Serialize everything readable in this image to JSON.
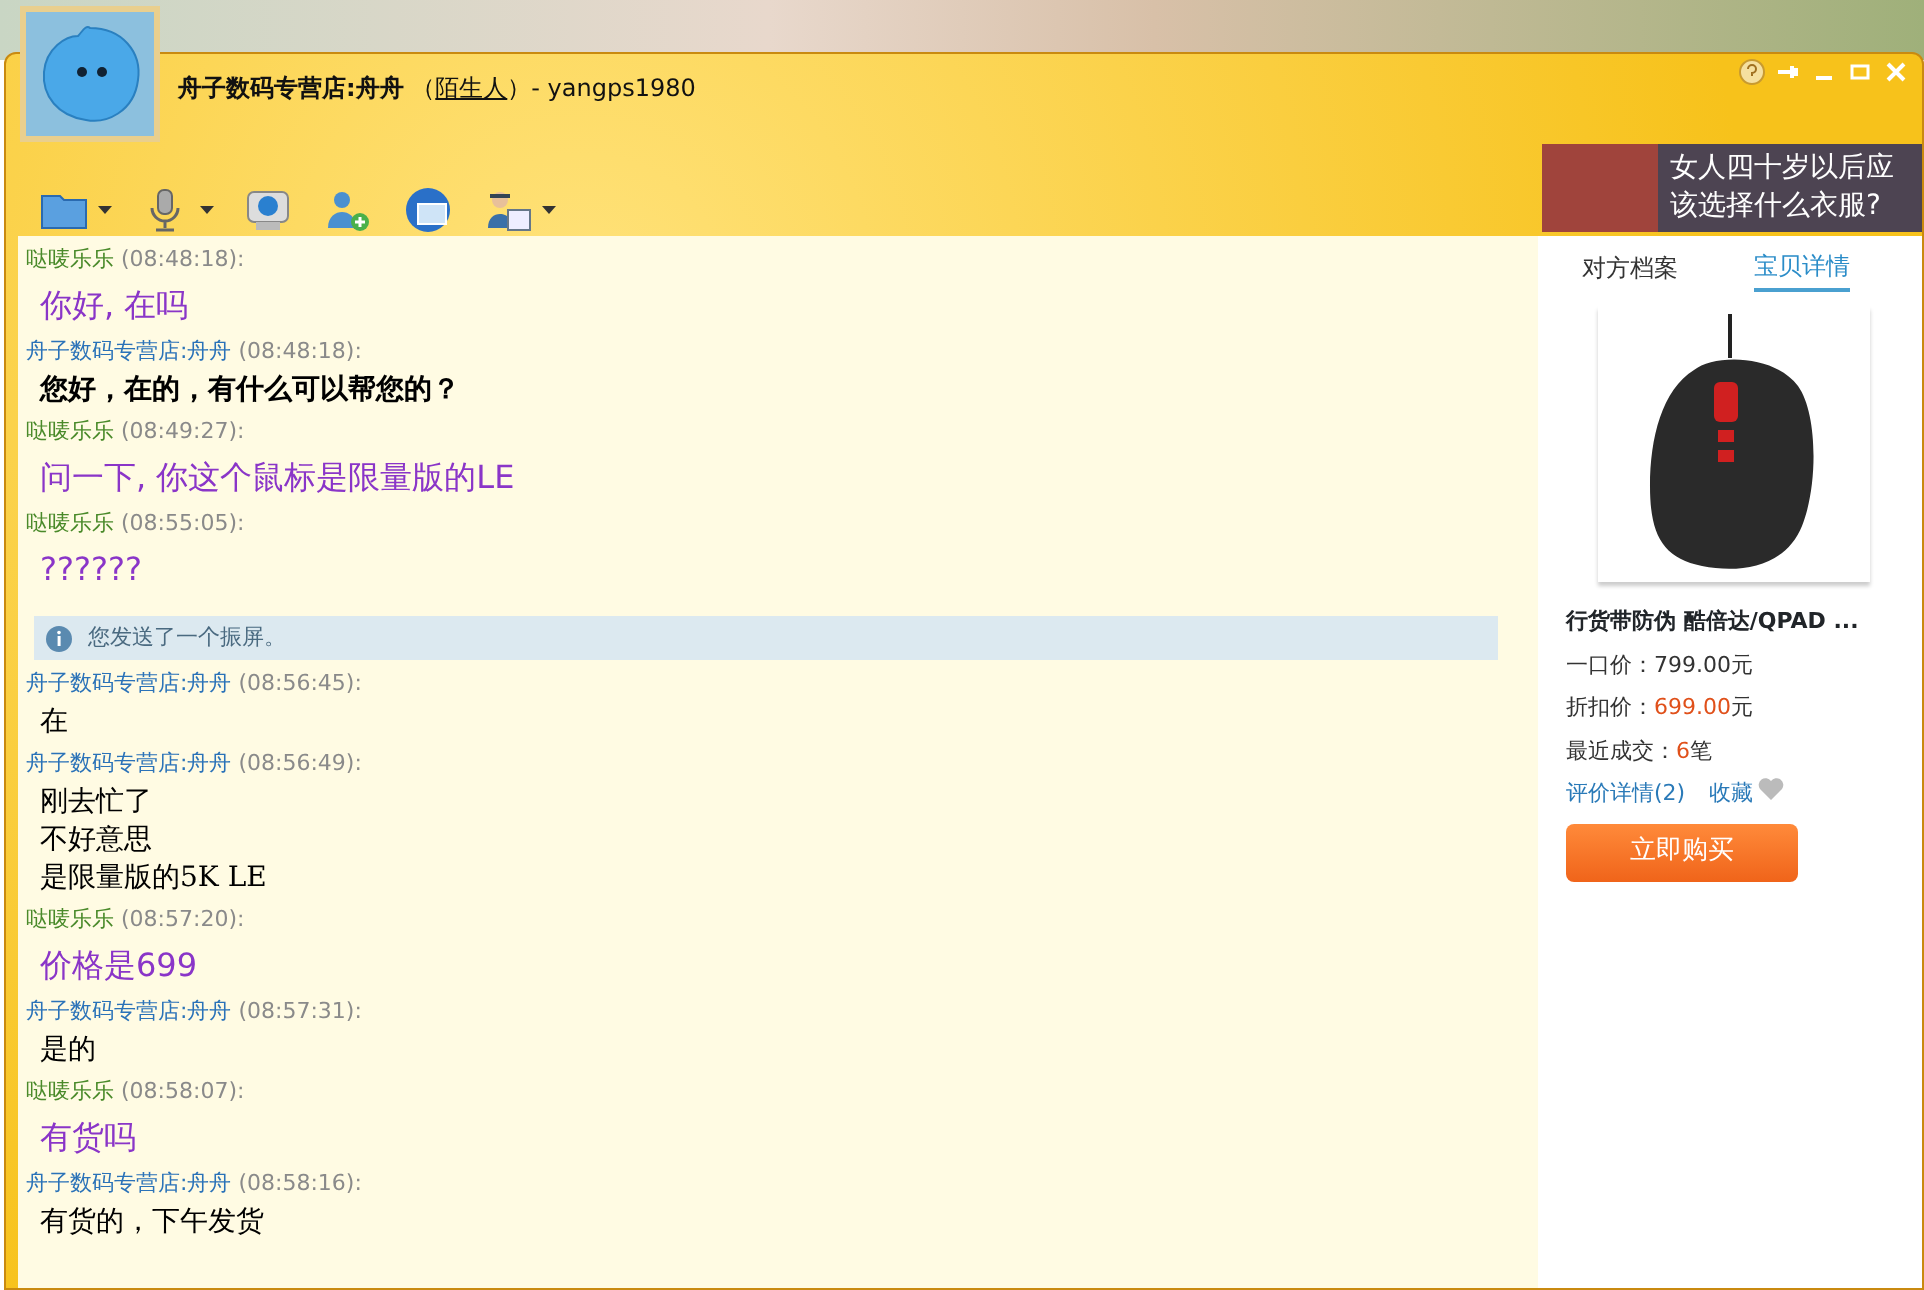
{
  "window": {
    "title_name": "舟子数码专营店:舟舟",
    "relation_open": "（",
    "relation": "陌生人",
    "relation_close": "）- yangps1980"
  },
  "toolbar": [
    {
      "kind": "folder",
      "has_menu": true
    },
    {
      "kind": "microphone",
      "has_menu": true
    },
    {
      "kind": "camera",
      "has_menu": false
    },
    {
      "kind": "contact",
      "has_menu": false
    },
    {
      "kind": "globe",
      "has_menu": false
    },
    {
      "kind": "agent",
      "has_menu": true
    }
  ],
  "ad": {
    "lines": [
      "女人四十岁以后应",
      "该选择什么衣服?"
    ]
  },
  "messages": [
    {
      "kind": "buyer",
      "sender": "哒唛乐乐",
      "time": "(08:48:18):",
      "lines": [
        "你好, 在吗"
      ],
      "bold": false
    },
    {
      "kind": "seller",
      "sender": "舟子数码专营店:舟舟",
      "time": "(08:48:18):",
      "lines": [
        "您好，在的，有什么可以帮您的？"
      ],
      "bold": true
    },
    {
      "kind": "buyer",
      "sender": "哒唛乐乐",
      "time": "(08:49:27):",
      "lines": [
        "问一下, 你这个鼠标是限量版的LE"
      ],
      "bold": false
    },
    {
      "kind": "buyer",
      "sender": "哒唛乐乐",
      "time": "(08:55:05):",
      "lines": [
        "??????"
      ],
      "bold": false
    },
    {
      "kind": "notice",
      "text": "您发送了一个振屏。"
    },
    {
      "kind": "seller",
      "sender": "舟子数码专营店:舟舟",
      "time": "(08:56:45):",
      "lines": [
        "在"
      ],
      "bold": false
    },
    {
      "kind": "seller",
      "sender": "舟子数码专营店:舟舟",
      "time": "(08:56:49):",
      "lines": [
        "刚去忙了",
        "不好意思",
        "是限量版的5K LE"
      ],
      "bold": false
    },
    {
      "kind": "buyer",
      "sender": "哒唛乐乐",
      "time": "(08:57:20):",
      "lines": [
        "价格是699"
      ],
      "bold": false
    },
    {
      "kind": "seller",
      "sender": "舟子数码专营店:舟舟",
      "time": "(08:57:31):",
      "lines": [
        "是的"
      ],
      "bold": false
    },
    {
      "kind": "buyer",
      "sender": "哒唛乐乐",
      "time": "(08:58:07):",
      "lines": [
        "有货吗"
      ],
      "bold": false
    },
    {
      "kind": "seller",
      "sender": "舟子数码专营店:舟舟",
      "time": "(08:58:16):",
      "lines": [
        "有货的，下午发货"
      ],
      "bold": false
    }
  ],
  "side_tabs": [
    {
      "label": "对方档案",
      "selected": false
    },
    {
      "label": "宝贝详情",
      "selected": true
    }
  ],
  "product": {
    "title": "行货带防伪 酷倍达/QPAD ...",
    "rows": [
      {
        "label": "一口价：",
        "value": "799.00",
        "unit": "元",
        "highlight": false
      },
      {
        "label": "折扣价：",
        "value": "699.00",
        "unit": "元",
        "highlight": true
      },
      {
        "label": "最近成交：",
        "value": "6",
        "unit": "笔",
        "highlight": true
      }
    ],
    "reviews_link": "评价详情(2)",
    "favorite_link": "收藏",
    "buy_button": "立即购买"
  }
}
